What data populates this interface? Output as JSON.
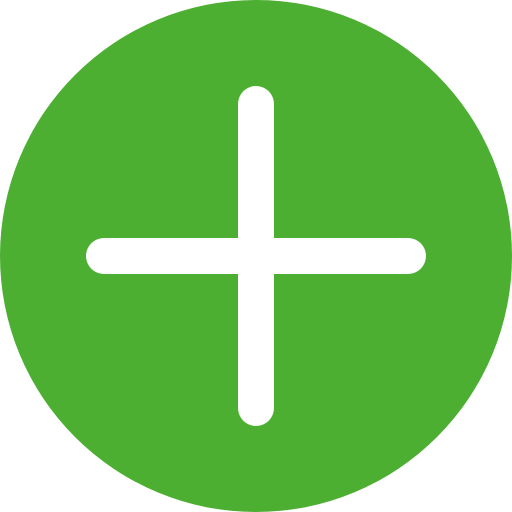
{
  "icon": {
    "name": "plus-circle-icon",
    "background_color": "#4caf32",
    "symbol_color": "#ffffff"
  }
}
